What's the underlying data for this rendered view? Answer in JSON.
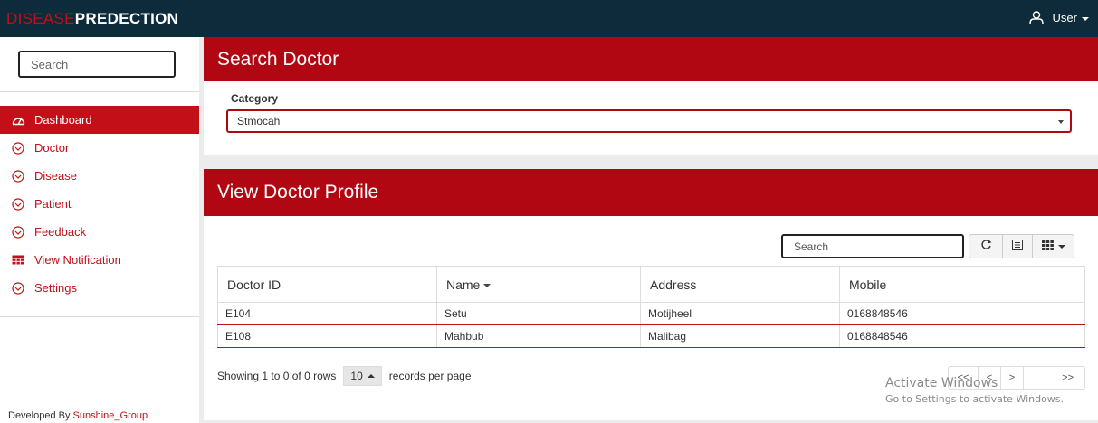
{
  "brand": {
    "part1": "DISEASE",
    "part2": "PREDECTION"
  },
  "user_menu": {
    "label": "User",
    "icon": "user-icon"
  },
  "sidebar": {
    "search_placeholder": "Search",
    "items": [
      {
        "label": "Dashboard",
        "icon": "dashboard-icon",
        "active": true
      },
      {
        "label": "Doctor",
        "icon": "chevron-circle-down-icon"
      },
      {
        "label": "Disease",
        "icon": "chevron-circle-down-icon"
      },
      {
        "label": "Patient",
        "icon": "chevron-circle-down-icon"
      },
      {
        "label": "Feedback",
        "icon": "chevron-circle-down-icon"
      },
      {
        "label": "View Notification",
        "icon": "table-icon"
      },
      {
        "label": "Settings",
        "icon": "chevron-circle-down-icon"
      }
    ],
    "footer_prefix": "Developed By ",
    "footer_link": "Sunshine_Group"
  },
  "search_panel": {
    "title": "Search Doctor",
    "category_label": "Category",
    "category_value": "Stmocah"
  },
  "profile_panel": {
    "title": "View Doctor Profile",
    "search_placeholder": "Search",
    "columns": [
      "Doctor ID",
      "Name",
      "Address",
      "Mobile"
    ],
    "rows": [
      [
        "E104",
        "Setu",
        "Motijheel",
        "0168848546"
      ],
      [
        "E108",
        "Mahbub",
        "Malibag",
        "0168848546"
      ]
    ],
    "pager": {
      "info": "Showing 1 to 0 of 0 rows",
      "page_size": "10",
      "suffix": "records per page",
      "first": "<<",
      "prev": "<",
      "next": ">",
      "last": ">>"
    }
  },
  "watermark": {
    "line1": "Activate Windows",
    "line2": "Go to Settings to activate Windows."
  },
  "colors": {
    "accent": "#b10712",
    "navbar": "#0d2b3a"
  }
}
